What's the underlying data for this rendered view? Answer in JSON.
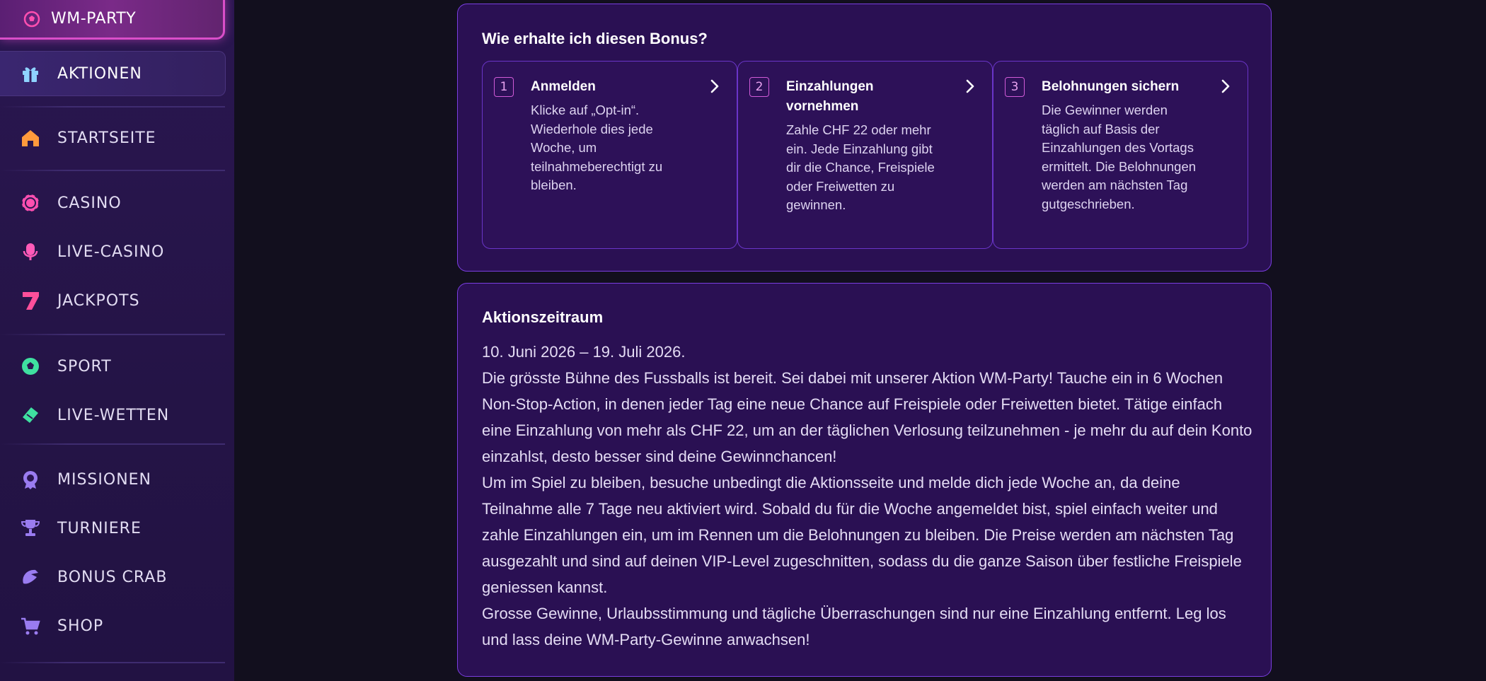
{
  "sidebar": {
    "promo": {
      "label": "WM-PARTY",
      "icon": "soccer-ball-icon"
    },
    "items": [
      {
        "label": "AKTIONEN",
        "icon": "gift-icon",
        "color": "#8fd3ff"
      },
      {
        "label": "STARTSEITE",
        "icon": "home-icon",
        "color": "#ff9a3c"
      },
      {
        "label": "CASINO",
        "icon": "casino-chip-icon",
        "color": "#ff4fb0"
      },
      {
        "label": "LIVE-CASINO",
        "icon": "microphone-icon",
        "color": "#ff5ab8"
      },
      {
        "label": "JACKPOTS",
        "icon": "seven-icon",
        "color": "#ff4f9a"
      },
      {
        "label": "SPORT",
        "icon": "soccer-ball-icon",
        "color": "#3fe0a0"
      },
      {
        "label": "LIVE-WETTEN",
        "icon": "ticket-icon",
        "color": "#3fe0a0"
      },
      {
        "label": "MISSIONEN",
        "icon": "badge-icon",
        "color": "#9a7cf0"
      },
      {
        "label": "TURNIERE",
        "icon": "trophy-icon",
        "color": "#9a7cf0"
      },
      {
        "label": "BONUS CRAB",
        "icon": "claw-icon",
        "color": "#9a7cf0"
      },
      {
        "label": "SHOP",
        "icon": "cart-icon",
        "color": "#9a7cf0"
      }
    ]
  },
  "howto": {
    "title": "Wie erhalte ich diesen Bonus?",
    "steps": [
      {
        "num": "1",
        "title": "Anmelden",
        "text": "Klicke auf „Opt-in“. Wiederhole dies jede Woche, um teilnahmeberechtigt zu bleiben."
      },
      {
        "num": "2",
        "title": "Einzahlungen vornehmen",
        "text": "Zahle CHF 22 oder mehr ein. Jede Einzahlung gibt dir die Chance, Freispiele oder Freiwetten zu gewinnen."
      },
      {
        "num": "3",
        "title": "Belohnungen sichern",
        "text": "Die Gewinner werden täglich auf Basis der Einzahlungen des Vortags ermittelt. Die Belohnungen werden am nächsten Tag gutgeschrieben."
      }
    ]
  },
  "period": {
    "title": "Aktionszeitraum",
    "paragraphs": [
      "10. Juni 2026 – 19. Juli 2026.",
      "Die grösste Bühne des Fussballs ist bereit. Sei dabei mit unserer Aktion WM-Party! Tauche ein in 6 Wochen Non-Stop-Action, in denen jeder Tag eine neue Chance auf Freispiele oder Freiwetten bietet. Tätige einfach eine Einzahlung von mehr als CHF 22, um an der täglichen Verlosung teilzunehmen - je mehr du auf dein Konto einzahlst, desto besser sind deine Gewinnchancen!",
      "Um im Spiel zu bleiben, besuche unbedingt die Aktionsseite und melde dich jede Woche an, da deine Teilnahme alle 7 Tage neu aktiviert wird. Sobald du für die Woche angemeldet bist, spiel einfach weiter und zahle Einzahlungen ein, um im Rennen um die Belohnungen zu bleiben. Die Preise werden am nächsten Tag ausgezahlt und sind auf deinen VIP-Level zugeschnitten, sodass du die ganze Saison über festliche Freispiele geniessen kannst.",
      "Grosse Gewinne, Urlaubsstimmung und tägliche Überraschungen sind nur eine Einzahlung entfernt. Leg los und lass deine WM-Party-Gewinne anwachsen!"
    ]
  }
}
